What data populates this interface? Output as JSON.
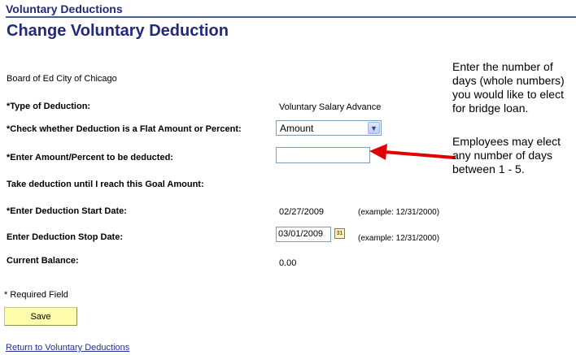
{
  "section_title": "Voluntary Deductions",
  "page_title": "Change Voluntary Deduction",
  "organization": "Board of Ed City of Chicago",
  "fields": {
    "type_label": "*Type of Deduction:",
    "type_value": "Voluntary Salary Advance",
    "flat_or_percent_label": "*Check whether Deduction is a Flat Amount or Percent:",
    "flat_or_percent_value": "Amount",
    "amount_label": "*Enter Amount/Percent to be deducted:",
    "amount_value": "",
    "goal_label": "Take deduction until I reach this Goal Amount:",
    "start_label": "*Enter Deduction Start Date:",
    "start_value": "02/27/2009",
    "start_example": "(example: 12/31/2000)",
    "stop_label": "Enter Deduction Stop Date:",
    "stop_value": "03/01/2009",
    "stop_example": "(example: 12/31/2000)",
    "balance_label": "Current Balance:",
    "balance_value": "0.00"
  },
  "required_note": "* Required Field",
  "save_label": "Save",
  "return_link": "Return to Voluntary Deductions",
  "calendar_icon_text": "31",
  "annotation": {
    "line1": "Enter the number of",
    "line2": "days (whole numbers)",
    "line3": "you would like to elect",
    "line4": "for bridge loan.",
    "line5": "Employees may elect",
    "line6": "any number of days",
    "line7": "between 1 - 5."
  },
  "colors": {
    "title": "#24297a",
    "save_button": "#fdfdab",
    "arrow": "#e00000"
  }
}
